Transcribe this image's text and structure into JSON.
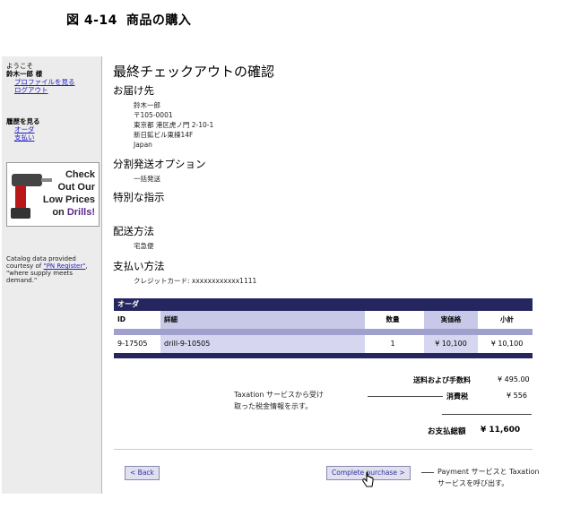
{
  "figure": {
    "number": "図 4-14",
    "title": "商品の購入"
  },
  "sidebar": {
    "welcome": "ようこそ",
    "user_name": "鈴木一郎 様",
    "profile_link": "プロファイルを見る",
    "logout_link": "ログアウト",
    "history_heading": "履歴を見る",
    "orders_link": "オーダ",
    "payments_link": "支払い",
    "ad": {
      "line1": "Check",
      "line2": "Out Our",
      "line3": "Low Prices",
      "line4_prefix": "on ",
      "line4_accent": "Drills!"
    },
    "catalog_prefix": "Catalog data provided courtesy of ",
    "catalog_link": "\"PN Register\"",
    "catalog_suffix": ", \"where supply meets demand.\""
  },
  "main": {
    "title": "最終チェックアウトの確認",
    "ship_to_heading": "お届け先",
    "address": [
      "鈴木一郎",
      "〒105-0001",
      "東京都 港区虎ノ門 2-10-1",
      "新日鉱ビル東棟14F",
      "Japan"
    ],
    "split_heading": "分割発送オプション",
    "split_value": "一括発送",
    "special_heading": "特別な指示",
    "delivery_heading": "配送方法",
    "delivery_value": "宅急便",
    "payment_heading": "支払い方法",
    "payment_value": "クレジットカード: xxxxxxxxxxxx1111"
  },
  "order": {
    "header": "オーダ",
    "columns": {
      "id": "ID",
      "detail": "詳細",
      "qty": "数量",
      "price": "実価格",
      "subtotal": "小計"
    },
    "rows": [
      {
        "id": "9-17505",
        "detail": "drill-9-10505",
        "qty": "1",
        "price": "¥ 10,100",
        "subtotal": "¥ 10,100"
      }
    ]
  },
  "summary": {
    "shipping_label": "送料および手数料",
    "shipping_value": "¥ 495.00",
    "tax_label": "消費税",
    "tax_value": "¥ 556",
    "total_label": "お支払総額",
    "total_value": "¥ 11,600"
  },
  "annotations": {
    "tax_note_line1": "Taxation サービスから受け",
    "tax_note_line2": "取った税金情報を示す。",
    "payment_note_line1": "Payment サービスと Taxation",
    "payment_note_line2": "サービスを呼び出す。"
  },
  "buttons": {
    "back": "< Back",
    "complete": "Complete purchase >"
  }
}
